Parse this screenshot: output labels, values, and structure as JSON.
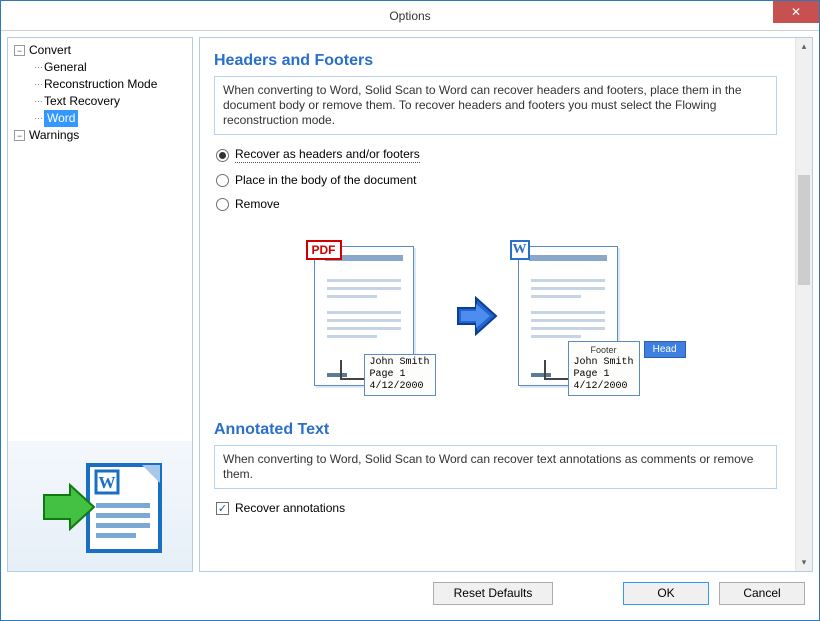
{
  "window": {
    "title": "Options",
    "close": "✕"
  },
  "tree": {
    "convert": {
      "label": "Convert",
      "expander": "−",
      "children": {
        "general": "General",
        "reconstruction": "Reconstruction Mode",
        "textrecovery": "Text Recovery",
        "word": "Word"
      }
    },
    "warnings": {
      "label": "Warnings",
      "expander": "−"
    }
  },
  "sections": {
    "headersFooters": {
      "title": "Headers and Footers",
      "description": "When converting to Word, Solid Scan to Word can recover headers and footers, place them in the document body or remove them. To recover headers and footers you must select the Flowing reconstruction mode.",
      "options": {
        "recover": "Recover as headers and/or footers",
        "body": "Place in the body of the document",
        "remove": "Remove"
      }
    },
    "annotated": {
      "title": "Annotated Text",
      "description": "When converting to Word, Solid Scan to Word can recover text annotations as comments or remove them.",
      "checkbox": "Recover annotations"
    }
  },
  "illustration": {
    "pdfBadge": "PDF",
    "wordBadge": "W",
    "calloutPdf": {
      "line1": "John Smith",
      "line2": "Page 1",
      "line3": "4/12/2000"
    },
    "calloutWord": {
      "title": "Footer",
      "line1": "John Smith",
      "line2": "Page 1",
      "line3": "4/12/2000"
    },
    "overlap": "Head"
  },
  "buttons": {
    "reset": "Reset Defaults",
    "ok": "OK",
    "cancel": "Cancel"
  }
}
